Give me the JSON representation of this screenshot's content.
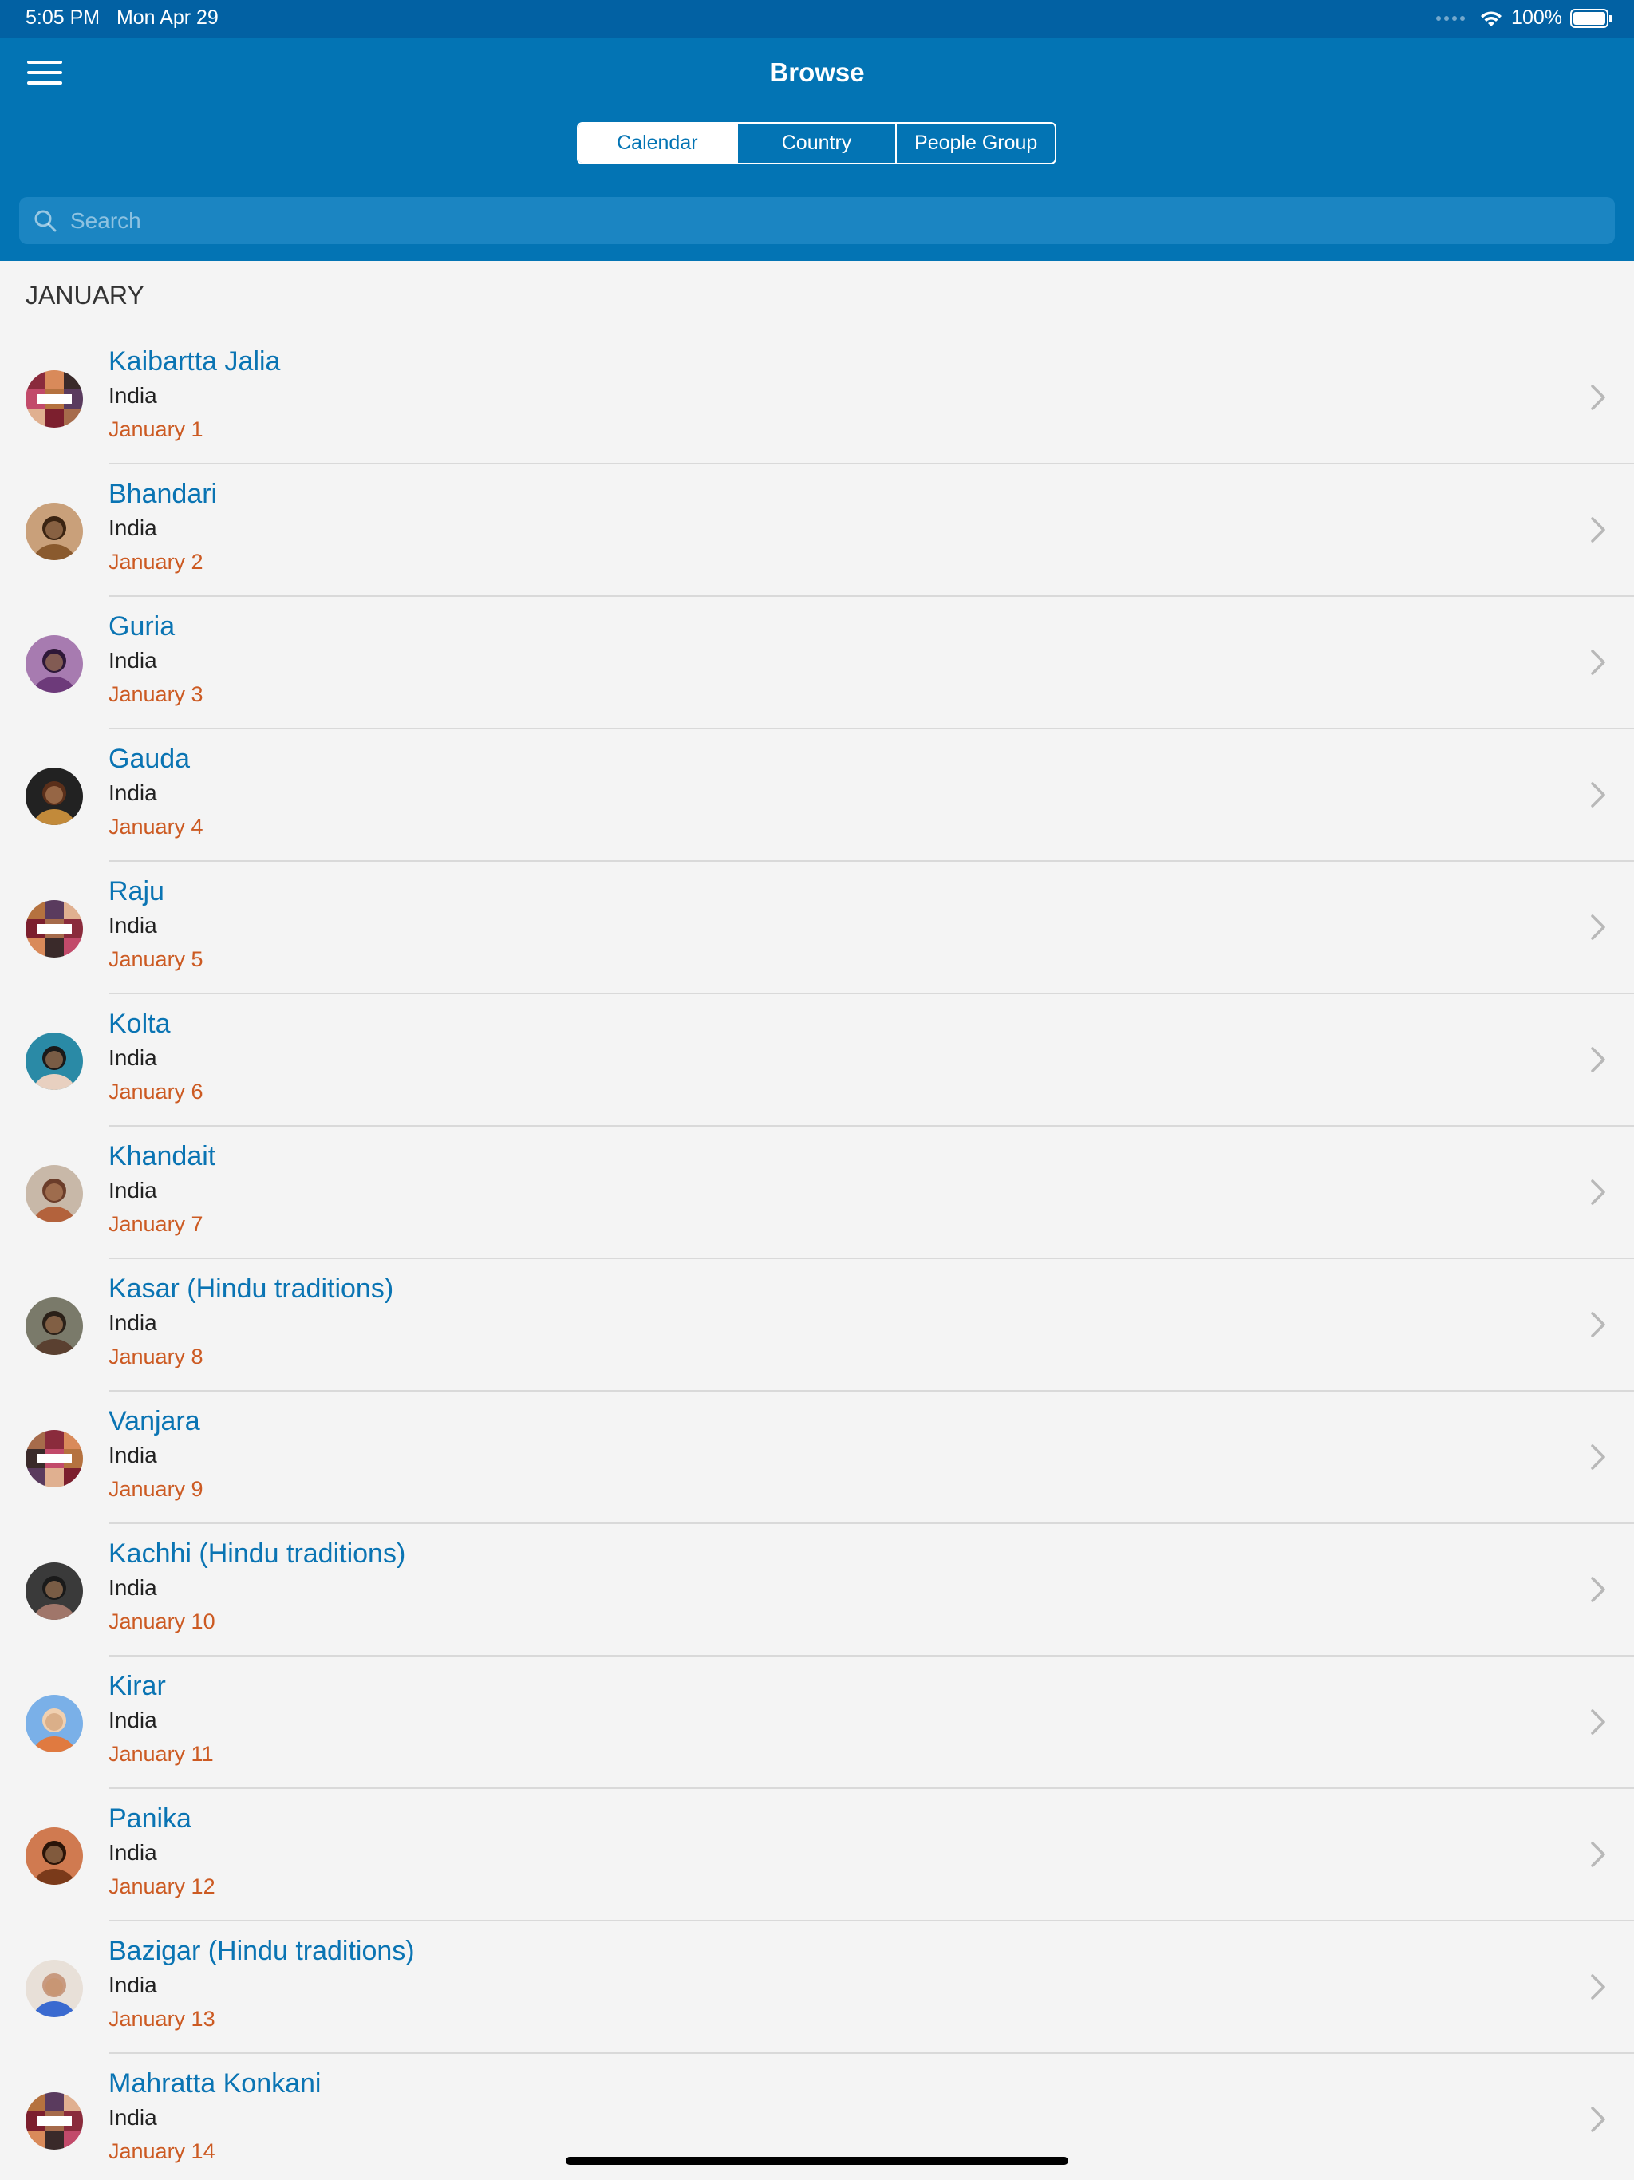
{
  "status_bar": {
    "time": "5:05 PM",
    "date": "Mon Apr 29",
    "battery": "100%"
  },
  "nav": {
    "title": "Browse",
    "menu_icon": "hamburger-menu-icon"
  },
  "tabs": [
    {
      "label": "Calendar",
      "active": true
    },
    {
      "label": "Country",
      "active": false
    },
    {
      "label": "People Group",
      "active": false
    }
  ],
  "search": {
    "placeholder": "Search",
    "value": ""
  },
  "section": {
    "title": "JANUARY"
  },
  "items": [
    {
      "name": "Kaibartta Jalia",
      "country": "India",
      "date": "January 1",
      "avatar": "photo-needed-collage"
    },
    {
      "name": "Bhandari",
      "country": "India",
      "date": "January 2",
      "avatar": "person-photo"
    },
    {
      "name": "Guria",
      "country": "India",
      "date": "January 3",
      "avatar": "person-photo"
    },
    {
      "name": "Gauda",
      "country": "India",
      "date": "January 4",
      "avatar": "person-photo"
    },
    {
      "name": "Raju",
      "country": "India",
      "date": "January 5",
      "avatar": "photo-needed-collage"
    },
    {
      "name": "Kolta",
      "country": "India",
      "date": "January 6",
      "avatar": "person-photo"
    },
    {
      "name": "Khandait",
      "country": "India",
      "date": "January 7",
      "avatar": "person-photo"
    },
    {
      "name": "Kasar (Hindu traditions)",
      "country": "India",
      "date": "January 8",
      "avatar": "person-photo"
    },
    {
      "name": "Vanjara",
      "country": "India",
      "date": "January 9",
      "avatar": "photo-needed-collage"
    },
    {
      "name": "Kachhi (Hindu traditions)",
      "country": "India",
      "date": "January 10",
      "avatar": "person-photo"
    },
    {
      "name": "Kirar",
      "country": "India",
      "date": "January 11",
      "avatar": "person-photo"
    },
    {
      "name": "Panika",
      "country": "India",
      "date": "January 12",
      "avatar": "person-photo"
    },
    {
      "name": "Bazigar (Hindu traditions)",
      "country": "India",
      "date": "January 13",
      "avatar": "person-photo"
    },
    {
      "name": "Mahratta Konkani",
      "country": "India",
      "date": "January 14",
      "avatar": "photo-needed-collage"
    }
  ],
  "colors": {
    "header_bg": "#0374b4",
    "status_bg": "#0261a3",
    "name_text": "#0a74b3",
    "date_text": "#cc5a22",
    "list_bg": "#f4f4f4"
  }
}
